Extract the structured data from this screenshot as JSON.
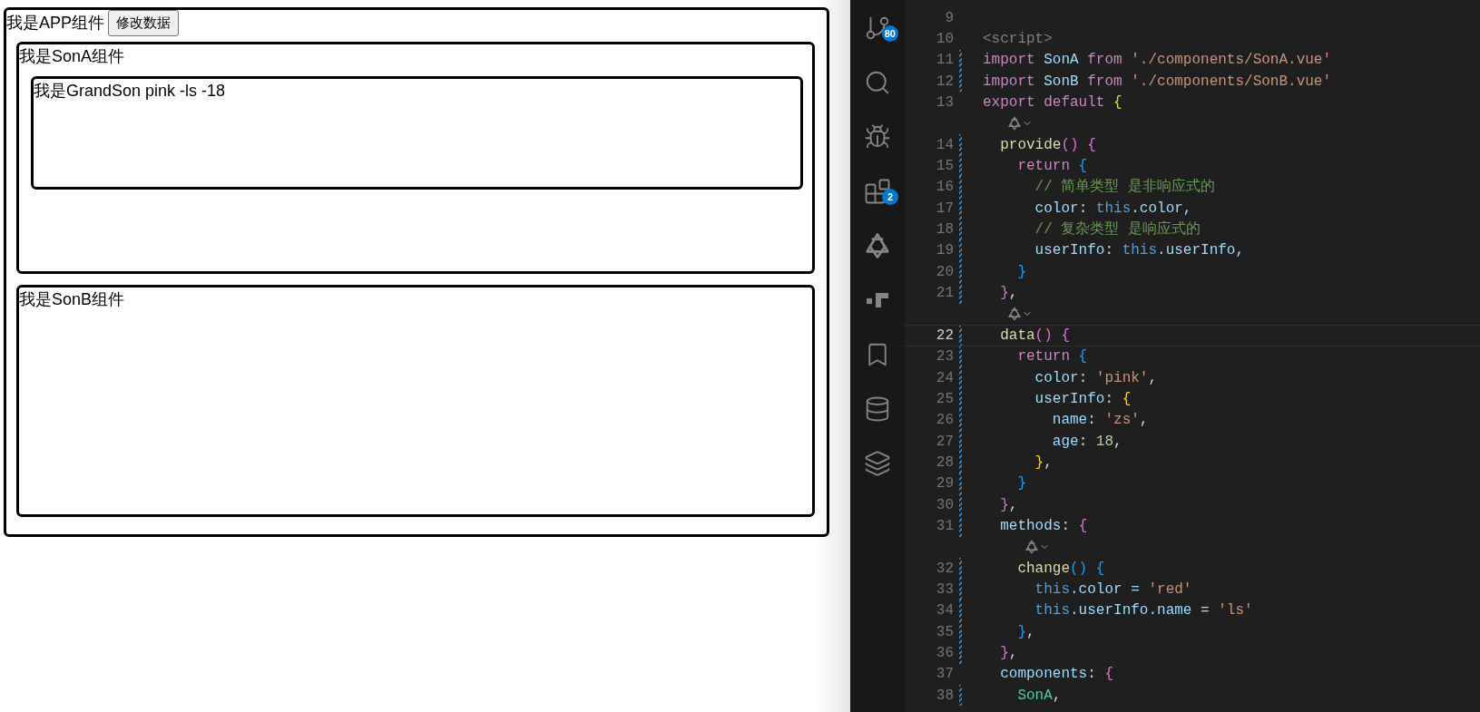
{
  "preview": {
    "app": {
      "label": "我是APP组件",
      "button": "修改数据"
    },
    "son_a": {
      "label": "我是SonA组件",
      "grandson": {
        "label": "我是GrandSon pink -ls -18"
      }
    },
    "son_b": {
      "label": "我是SonB组件"
    }
  },
  "activity_bar": [
    {
      "kind": "source-control",
      "badge": "80"
    },
    {
      "kind": "search"
    },
    {
      "kind": "debug"
    },
    {
      "kind": "extensions",
      "badge": "2"
    },
    {
      "kind": "logo"
    },
    {
      "kind": "blocks"
    },
    {
      "kind": "bookmark"
    },
    {
      "kind": "database"
    },
    {
      "kind": "layers"
    }
  ],
  "editor": {
    "lines": [
      {
        "number": "9",
        "modified": false,
        "current": false,
        "codelens": false
      },
      {
        "number": "10",
        "modified": false,
        "current": false,
        "codelens": false,
        "tokens": [
          {
            "text": "<script>",
            "kind": "tag"
          }
        ]
      },
      {
        "number": "11",
        "modified": true,
        "current": false,
        "codelens": false,
        "tokens": [
          {
            "text": "import",
            "kind": "keyword"
          },
          {
            "text": " SonA ",
            "kind": "variable"
          },
          {
            "text": "from",
            "kind": "keyword"
          },
          {
            "text": " './components/SonA.vue'",
            "kind": "string"
          }
        ]
      },
      {
        "number": "12",
        "modified": true,
        "current": false,
        "codelens": false,
        "tokens": [
          {
            "text": "import",
            "kind": "keyword"
          },
          {
            "text": " SonB ",
            "kind": "variable"
          },
          {
            "text": "from",
            "kind": "keyword"
          },
          {
            "text": " './components/SonB.vue'",
            "kind": "string"
          }
        ]
      },
      {
        "number": "13",
        "modified": false,
        "current": false,
        "codelens": false,
        "tokens": [
          {
            "text": "export default ",
            "kind": "keyword"
          },
          {
            "text": "{",
            "kind": "bracket1"
          }
        ]
      },
      {
        "number": "14",
        "modified": true,
        "current": false,
        "codelens": true,
        "tokens": [
          {
            "text": "  provide",
            "kind": "function"
          },
          {
            "text": "()",
            "kind": "bracket2"
          },
          {
            "text": " {",
            "kind": "bracket2"
          }
        ]
      },
      {
        "number": "15",
        "modified": true,
        "current": false,
        "codelens": false,
        "tokens": [
          {
            "text": "    return",
            "kind": "keyword"
          },
          {
            "text": " {",
            "kind": "bracket3"
          }
        ]
      },
      {
        "number": "16",
        "modified": true,
        "current": false,
        "codelens": false,
        "tokens": [
          {
            "text": "      // 简单类型 是非响应式的",
            "kind": "comment"
          }
        ]
      },
      {
        "number": "17",
        "modified": true,
        "current": false,
        "codelens": false,
        "tokens": [
          {
            "text": "      color",
            "kind": "variable"
          },
          {
            "text": ": ",
            "kind": "plain"
          },
          {
            "text": "this",
            "kind": "this"
          },
          {
            "text": ".color,",
            "kind": "variable"
          }
        ]
      },
      {
        "number": "18",
        "modified": true,
        "current": false,
        "codelens": false,
        "tokens": [
          {
            "text": "      // 复杂类型 是响应式的",
            "kind": "comment"
          }
        ]
      },
      {
        "number": "19",
        "modified": true,
        "current": false,
        "codelens": false,
        "tokens": [
          {
            "text": "      userInfo",
            "kind": "variable"
          },
          {
            "text": ": ",
            "kind": "plain"
          },
          {
            "text": "this",
            "kind": "this"
          },
          {
            "text": ".userInfo,",
            "kind": "variable"
          }
        ]
      },
      {
        "number": "20",
        "modified": true,
        "current": false,
        "codelens": false,
        "tokens": [
          {
            "text": "    }",
            "kind": "bracket3"
          }
        ]
      },
      {
        "number": "21",
        "modified": true,
        "current": false,
        "codelens": false,
        "tokens": [
          {
            "text": "  }",
            "kind": "bracket2"
          },
          {
            "text": ",",
            "kind": "plain"
          }
        ]
      },
      {
        "number": "22",
        "modified": true,
        "current": true,
        "codelens": true,
        "tokens": [
          {
            "text": "  data",
            "kind": "function"
          },
          {
            "text": "()",
            "kind": "bracket2"
          },
          {
            "text": " {",
            "kind": "bracket2"
          }
        ]
      },
      {
        "number": "23",
        "modified": true,
        "current": false,
        "codelens": false,
        "tokens": [
          {
            "text": "    return",
            "kind": "keyword"
          },
          {
            "text": " {",
            "kind": "bracket3"
          }
        ]
      },
      {
        "number": "24",
        "modified": true,
        "current": false,
        "codelens": false,
        "tokens": [
          {
            "text": "      color",
            "kind": "variable"
          },
          {
            "text": ": ",
            "kind": "plain"
          },
          {
            "text": "'pink'",
            "kind": "string"
          },
          {
            "text": ",",
            "kind": "plain"
          }
        ]
      },
      {
        "number": "25",
        "modified": true,
        "current": false,
        "codelens": false,
        "tokens": [
          {
            "text": "      userInfo",
            "kind": "variable"
          },
          {
            "text": ": ",
            "kind": "plain"
          },
          {
            "text": "{",
            "kind": "bracket1"
          }
        ]
      },
      {
        "number": "26",
        "modified": true,
        "current": false,
        "codelens": false,
        "tokens": [
          {
            "text": "        name",
            "kind": "variable"
          },
          {
            "text": ": ",
            "kind": "plain"
          },
          {
            "text": "'zs'",
            "kind": "string"
          },
          {
            "text": ",",
            "kind": "plain"
          }
        ]
      },
      {
        "number": "27",
        "modified": true,
        "current": false,
        "codelens": false,
        "tokens": [
          {
            "text": "        age",
            "kind": "variable"
          },
          {
            "text": ": ",
            "kind": "plain"
          },
          {
            "text": "18",
            "kind": "number"
          },
          {
            "text": ",",
            "kind": "plain"
          }
        ]
      },
      {
        "number": "28",
        "modified": true,
        "current": false,
        "codelens": false,
        "tokens": [
          {
            "text": "      }",
            "kind": "bracket1"
          },
          {
            "text": ",",
            "kind": "plain"
          }
        ]
      },
      {
        "number": "29",
        "modified": true,
        "current": false,
        "codelens": false,
        "tokens": [
          {
            "text": "    }",
            "kind": "bracket3"
          }
        ]
      },
      {
        "number": "30",
        "modified": true,
        "current": false,
        "codelens": false,
        "tokens": [
          {
            "text": "  }",
            "kind": "bracket2"
          },
          {
            "text": ",",
            "kind": "plain"
          }
        ]
      },
      {
        "number": "31",
        "modified": true,
        "current": false,
        "codelens": false,
        "tokens": [
          {
            "text": "  methods",
            "kind": "variable"
          },
          {
            "text": ": ",
            "kind": "plain"
          },
          {
            "text": "{",
            "kind": "bracket2"
          }
        ]
      },
      {
        "number": "32",
        "modified": true,
        "current": false,
        "codelens": true,
        "tokens": [
          {
            "text": "    change",
            "kind": "function"
          },
          {
            "text": "()",
            "kind": "bracket3"
          },
          {
            "text": " {",
            "kind": "bracket3"
          }
        ]
      },
      {
        "number": "33",
        "modified": true,
        "current": false,
        "codelens": false,
        "tokens": [
          {
            "text": "      this",
            "kind": "this"
          },
          {
            "text": ".color = ",
            "kind": "variable"
          },
          {
            "text": "'red'",
            "kind": "string"
          }
        ]
      },
      {
        "number": "34",
        "modified": true,
        "current": false,
        "codelens": false,
        "tokens": [
          {
            "text": "      this",
            "kind": "this"
          },
          {
            "text": ".userInfo.name = ",
            "kind": "variable"
          },
          {
            "text": "'ls'",
            "kind": "string"
          }
        ]
      },
      {
        "number": "35",
        "modified": true,
        "current": false,
        "codelens": false,
        "tokens": [
          {
            "text": "    }",
            "kind": "bracket3"
          },
          {
            "text": ",",
            "kind": "plain"
          }
        ]
      },
      {
        "number": "36",
        "modified": true,
        "current": false,
        "codelens": false,
        "tokens": [
          {
            "text": "  }",
            "kind": "bracket2"
          },
          {
            "text": ",",
            "kind": "plain"
          }
        ]
      },
      {
        "number": "37",
        "modified": false,
        "current": false,
        "codelens": false,
        "tokens": [
          {
            "text": "  components",
            "kind": "variable"
          },
          {
            "text": ": ",
            "kind": "plain"
          },
          {
            "text": "{",
            "kind": "bracket2"
          }
        ]
      },
      {
        "number": "38",
        "modified": true,
        "current": false,
        "codelens": false,
        "tokens": [
          {
            "text": "    SonA",
            "kind": "class"
          },
          {
            "text": ",",
            "kind": "plain"
          }
        ]
      }
    ]
  }
}
